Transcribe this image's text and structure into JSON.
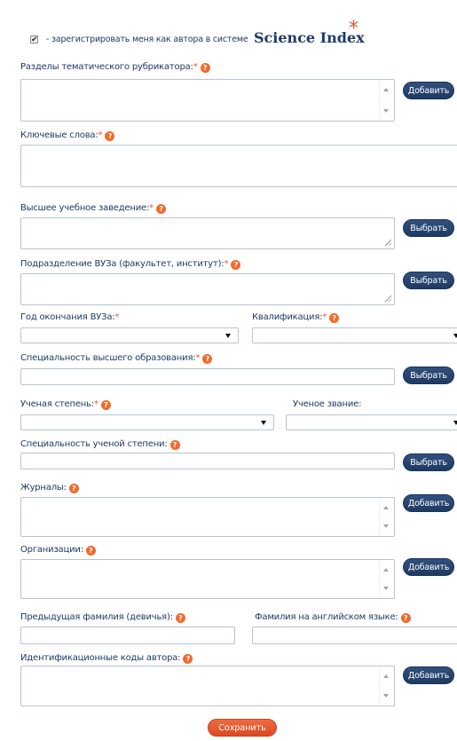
{
  "register": {
    "checked": true,
    "label": "- зарегистрировать меня как автора в системе",
    "brand": "Science Index",
    "brand_mark": "*"
  },
  "help_glyph": "?",
  "req_mark": "*",
  "rubricator": {
    "label": "Разделы тематического рубрикатора:",
    "button": "Добавить"
  },
  "keywords": {
    "label": "Ключевые слова:"
  },
  "university": {
    "label": "Высшее учебное заведение:",
    "button": "Выбрать"
  },
  "department": {
    "label": "Подразделение ВУЗа (факультет, институт):",
    "button": "Выбрать"
  },
  "graduation_year": {
    "label": "Год окончания ВУЗа:",
    "value": ""
  },
  "qualification": {
    "label": "Квалификация:",
    "value": ""
  },
  "higher_specialty": {
    "label": "Специальность высшего образования:",
    "button": "Выбрать"
  },
  "degree": {
    "label": "Ученая степень:",
    "value": ""
  },
  "title": {
    "label": "Ученое звание:",
    "value": ""
  },
  "degree_specialty": {
    "label": "Специальность ученой степени:",
    "button": "Выбрать"
  },
  "journals": {
    "label": "Журналы:",
    "button": "Добавить"
  },
  "organizations": {
    "label": "Организации:",
    "button": "Добавить"
  },
  "maiden_name": {
    "label": "Предыдущая фамилия (девичья):",
    "value": ""
  },
  "english_surname": {
    "label": "Фамилия на английском языке:",
    "value": ""
  },
  "author_ids": {
    "label": "Идентификационные коды автора:",
    "button": "Добавить"
  },
  "save_button": "Сохранить"
}
